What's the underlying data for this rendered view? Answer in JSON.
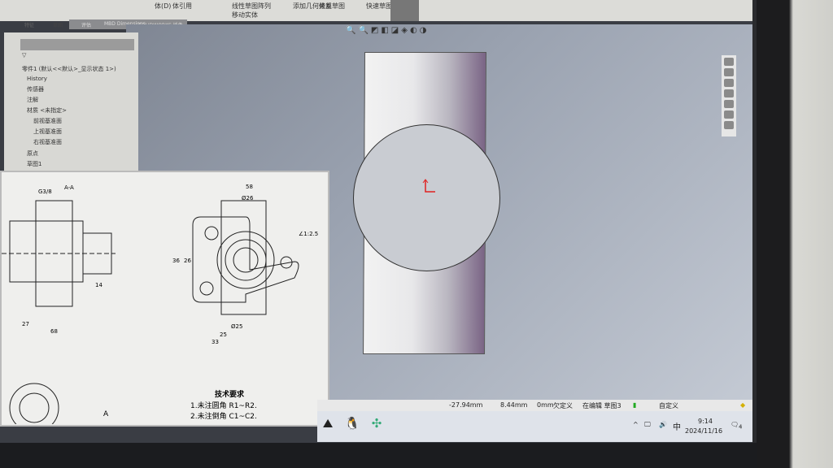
{
  "ribbon": {
    "items": [
      "体(D)",
      "体引用",
      "",
      "线性草图阵列",
      "移动实体",
      "添加几何关系",
      "修复草图",
      "快速草图"
    ]
  },
  "tabs": [
    "特征",
    "草图",
    "评估",
    "MBD Dimensions",
    "SOLIDWORKS 插件"
  ],
  "tree": {
    "root": "零件1 (默认<<默认>_显示状态 1>)",
    "items": [
      "History",
      "传感器",
      "注解",
      "材质 <未指定>",
      "前视基准面",
      "上视基准面",
      "右视基准面",
      "原点",
      "草图1"
    ]
  },
  "drawing": {
    "section_label": "A-A",
    "tech_title": "技术要求",
    "notes": [
      "1.未注圆角 R1~R2.",
      "2.未注倒角 C1~C2."
    ],
    "dims": [
      "G3/8",
      "58",
      "Ø26",
      "Ø25",
      "36",
      "26",
      "25",
      "33",
      "68",
      "27",
      "14",
      "∠1:2.5",
      "A"
    ]
  },
  "status": {
    "x": "-27.94mm",
    "y": "8.44mm",
    "z": "0mm",
    "state": "欠定义",
    "editing": "在编辑 草图3",
    "units": "自定义"
  },
  "taskbar": {
    "ime": "中",
    "time": "9:14",
    "date": "2024/11/16",
    "notify_count": "4"
  },
  "colors": {
    "viewport": "#9aa2b0",
    "origin": "#e02020"
  }
}
